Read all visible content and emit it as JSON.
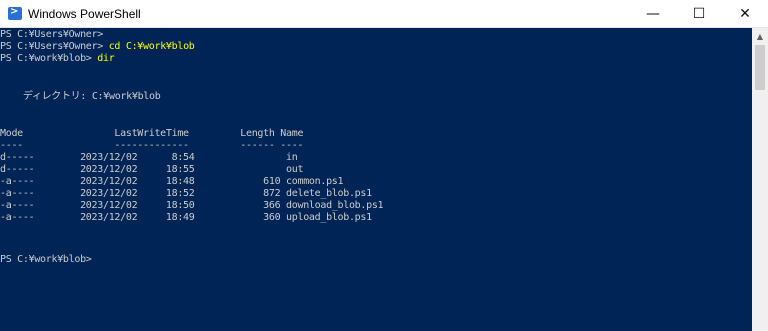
{
  "window": {
    "title": "Windows PowerShell",
    "icon": "powershell-icon",
    "controls": {
      "minimize": "—",
      "maximize": "☐",
      "close": "✕"
    }
  },
  "console": {
    "prompt_lines": [
      {
        "prompt": "PS C:¥Users¥Owner>",
        "command": ""
      },
      {
        "prompt": "PS C:¥Users¥Owner> ",
        "command": "cd C:¥work¥blob"
      },
      {
        "prompt": "PS C:¥work¥blob> ",
        "command": "dir"
      }
    ],
    "directory_label": "    ディレクトリ: C:¥work¥blob",
    "header": "Mode                LastWriteTime         Length Name",
    "separator": "----                -------------         ------ ----",
    "rows": [
      "d-----        2023/12/02      8:54                in",
      "d-----        2023/12/02     18:55                out",
      "-a----        2023/12/02     18:48            610 common.ps1",
      "-a----        2023/12/02     18:52            872 delete_blob.ps1",
      "-a----        2023/12/02     18:50            366 download_blob.ps1",
      "-a----        2023/12/02     18:49            360 upload_blob.ps1"
    ],
    "final_prompt": "PS C:¥work¥blob>"
  },
  "colors": {
    "background": "#012456",
    "text": "#cccccc",
    "command": "#ffff00"
  }
}
